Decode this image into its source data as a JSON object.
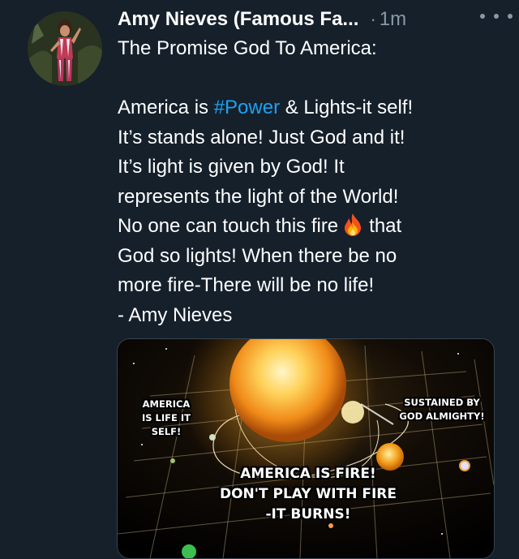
{
  "tweet": {
    "display_name": "Amy Nieves (Famous Fa...",
    "dot": "·",
    "timestamp": "1m",
    "lines": [
      "The Promise God To America:",
      "",
      "",
      "It’s stands alone! Just God and it!",
      "It’s light is given by God! It",
      "represents the light of the World!",
      "",
      "God so lights! When there be no",
      "more fire-There will be no life!",
      "- Amy Nieves"
    ],
    "line3_prefix": "America is ",
    "hashtag": "#Power",
    "line3_suffix": " & Lights-it self!",
    "line7_prefix": "No one can touch this fire",
    "line7_suffix": "that"
  },
  "media": {
    "caption_left": [
      "AMERICA",
      "IS LIFE IT SELF!"
    ],
    "caption_right": [
      "SUSTAINED BY",
      "GOD ALMIGHTY!"
    ],
    "caption_main": [
      "AMERICA IS FIRE!",
      "DON'T PLAY WITH FIRE",
      "-IT BURNS!"
    ]
  },
  "icons": {
    "more": "more-horizontal-icon",
    "emoji": "fire-emoji-icon"
  },
  "colors": {
    "background": "#15202b",
    "text": "#ffffff",
    "secondary": "#8899a6",
    "link": "#1da1f2"
  }
}
